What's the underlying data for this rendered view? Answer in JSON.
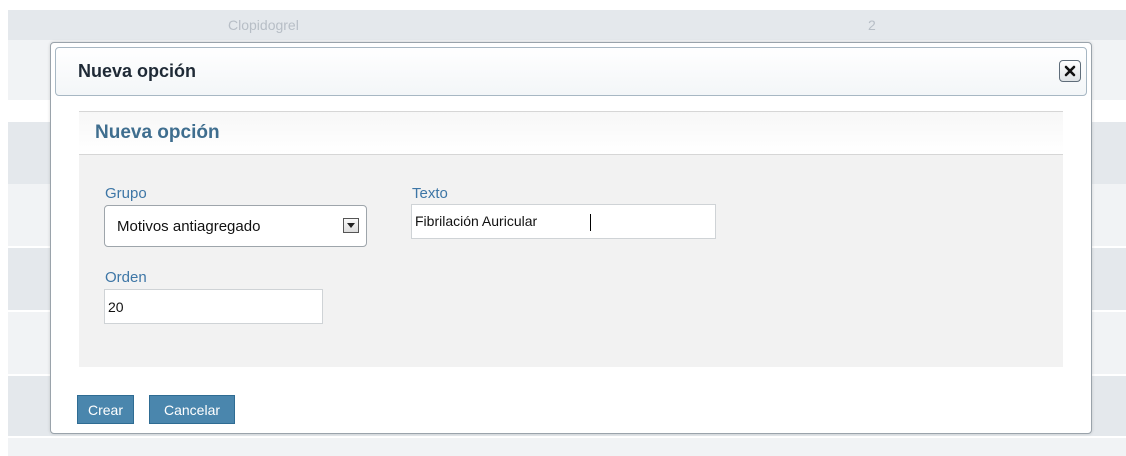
{
  "background": {
    "first_row": {
      "name": "Clopidogrel",
      "count": "2"
    }
  },
  "dialog": {
    "title": "Nueva opción",
    "close_icon": "close-x-icon",
    "panel_title": "Nueva opción",
    "fields": {
      "grupo": {
        "label": "Grupo",
        "value": "Motivos antiagregado"
      },
      "texto": {
        "label": "Texto",
        "value": "Fibrilación Auricular"
      },
      "orden": {
        "label": "Orden",
        "value": "20"
      }
    },
    "buttons": {
      "create": "Crear",
      "cancel": "Cancelar"
    }
  },
  "colors": {
    "accent": "#4a86ad",
    "label": "#3d76a6",
    "panel_title": "#3f6e8f"
  }
}
